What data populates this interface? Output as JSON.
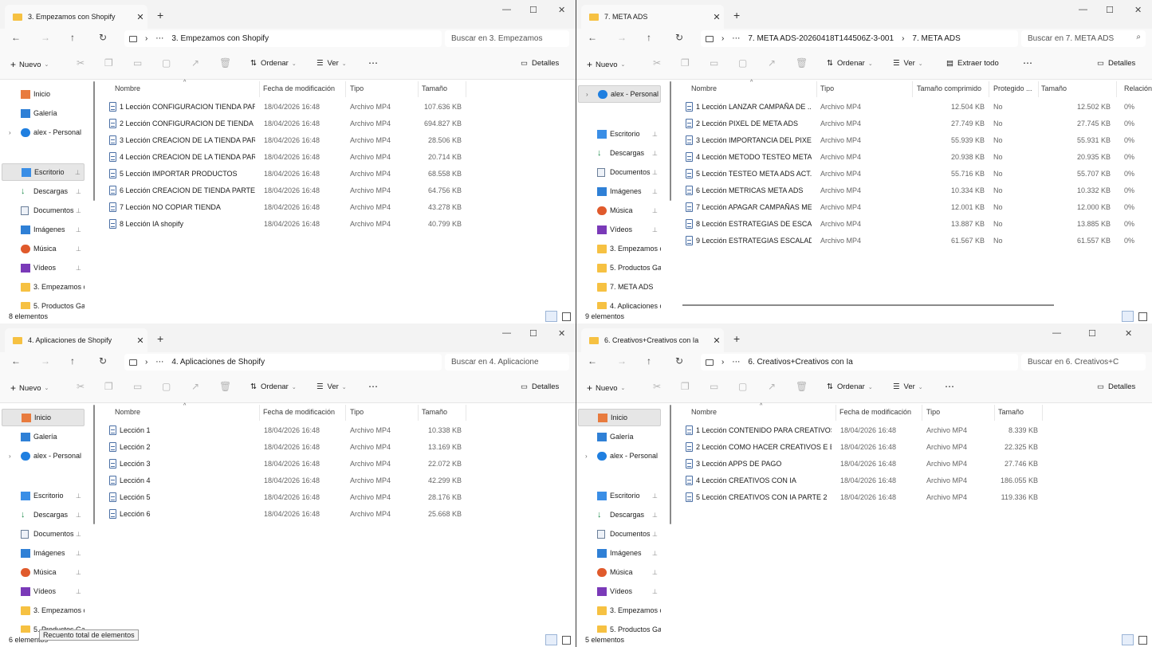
{
  "windows": [
    {
      "tab_title": "3. Empezamos con Shopify",
      "breadcrumb": [
        "3. Empezamos con Shopify"
      ],
      "search_placeholder": "Buscar en 3. Empezamos",
      "toolbar": {
        "new": "Nuevo",
        "sort": "Ordenar",
        "view": "Ver",
        "extract": "",
        "details": "Detalles"
      },
      "sidebar": [
        {
          "label": "Inicio",
          "icon": "home-icon",
          "selected": false
        },
        {
          "label": "Galería",
          "icon": "gallery-icon",
          "selected": false
        },
        {
          "label": "alex - Personal",
          "icon": "onedrive-icon",
          "selected": false,
          "expander": true
        },
        {
          "label": "Escritorio",
          "icon": "desktop-icon",
          "selected": true,
          "pinned": true
        },
        {
          "label": "Descargas",
          "icon": "downloads-icon",
          "pinned": true
        },
        {
          "label": "Documentos",
          "icon": "documents-icon",
          "pinned": true
        },
        {
          "label": "Imágenes",
          "icon": "pictures-icon",
          "pinned": true
        },
        {
          "label": "Música",
          "icon": "music-icon",
          "pinned": true
        },
        {
          "label": "Vídeos",
          "icon": "videos-icon",
          "pinned": true
        },
        {
          "label": "3. Empezamos c",
          "icon": "folder-icon"
        },
        {
          "label": "5. Productos Ga",
          "icon": "folder-icon"
        }
      ],
      "columns": [
        "Nombre",
        "Fecha de modificación",
        "Tipo",
        "Tamaño"
      ],
      "rows": [
        [
          "1 Lección CONFIGURACION TIENDA PAR...",
          "18/04/2026 16:48",
          "Archivo MP4",
          "107.636 KB"
        ],
        [
          "2 Lección CONFIGURACION DE TIENDA ...",
          "18/04/2026 16:48",
          "Archivo MP4",
          "694.827 KB"
        ],
        [
          "3 Lección CREACION DE LA TIENDA PAR...",
          "18/04/2026 16:48",
          "Archivo MP4",
          "28.506 KB"
        ],
        [
          "4 Lección CREACION DE LA TIENDA PAR...",
          "18/04/2026 16:48",
          "Archivo MP4",
          "20.714 KB"
        ],
        [
          "5 Lección IMPORTAR PRODUCTOS",
          "18/04/2026 16:48",
          "Archivo MP4",
          "68.558 KB"
        ],
        [
          "6 Lección CREACION DE TIENDA PARTE 4",
          "18/04/2026 16:48",
          "Archivo MP4",
          "64.756 KB"
        ],
        [
          "7 Lección NO COPIAR TIENDA",
          "18/04/2026 16:48",
          "Archivo MP4",
          "43.278 KB"
        ],
        [
          "8 Lección IA shopify",
          "18/04/2026 16:48",
          "Archivo MP4",
          "40.799 KB"
        ]
      ],
      "status": "8 elementos"
    },
    {
      "tab_title": "7. META ADS",
      "breadcrumb": [
        "7. META ADS-20260418T144506Z-3-001",
        "7. META ADS"
      ],
      "search_placeholder": "Buscar en 7. META ADS",
      "toolbar": {
        "new": "Nuevo",
        "sort": "Ordenar",
        "view": "Ver",
        "extract": "Extraer todo",
        "details": "Detalles"
      },
      "sidebar": [
        {
          "label": "alex - Personal",
          "icon": "onedrive-icon",
          "selected": true,
          "expander": true
        },
        {
          "label": "Escritorio",
          "icon": "desktop-icon",
          "pinned": true
        },
        {
          "label": "Descargas",
          "icon": "downloads-icon",
          "pinned": true
        },
        {
          "label": "Documentos",
          "icon": "documents-icon",
          "pinned": true
        },
        {
          "label": "Imágenes",
          "icon": "pictures-icon",
          "pinned": true
        },
        {
          "label": "Música",
          "icon": "music-icon",
          "pinned": true
        },
        {
          "label": "Vídeos",
          "icon": "videos-icon",
          "pinned": true
        },
        {
          "label": "3. Empezamos c",
          "icon": "folder-icon"
        },
        {
          "label": "5. Productos Ga",
          "icon": "folder-icon"
        },
        {
          "label": "7. META ADS",
          "icon": "folder-icon"
        },
        {
          "label": "4. Aplicaciones c",
          "icon": "folder-icon"
        }
      ],
      "columns": [
        "Nombre",
        "Tipo",
        "Tamaño comprimido",
        "Protegido ...",
        "Tamaño",
        "Relación"
      ],
      "rows": [
        [
          "1 Lección LANZAR CAMPAÑA DE ...",
          "Archivo MP4",
          "12.504 KB",
          "No",
          "12.502 KB",
          "0%"
        ],
        [
          "2 Lección PIXEL DE META ADS",
          "Archivo MP4",
          "27.749 KB",
          "No",
          "27.745 KB",
          "0%"
        ],
        [
          "3 Lección IMPORTANCIA DEL PIXEL",
          "Archivo MP4",
          "55.939 KB",
          "No",
          "55.931 KB",
          "0%"
        ],
        [
          "4 Lección METODO TESTEO META ...",
          "Archivo MP4",
          "20.938 KB",
          "No",
          "20.935 KB",
          "0%"
        ],
        [
          "5 Lección TESTEO META ADS ACT...",
          "Archivo MP4",
          "55.716 KB",
          "No",
          "55.707 KB",
          "0%"
        ],
        [
          "6 Lección METRICAS META ADS",
          "Archivo MP4",
          "10.334 KB",
          "No",
          "10.332 KB",
          "0%"
        ],
        [
          "7 Lección APAGAR CAMPAÑAS ME...",
          "Archivo MP4",
          "12.001 KB",
          "No",
          "12.000 KB",
          "0%"
        ],
        [
          "8 Lección ESTRATEGIAS DE ESCAL...",
          "Archivo MP4",
          "13.887 KB",
          "No",
          "13.885 KB",
          "0%"
        ],
        [
          "9 Lección ESTRATEGIAS ESCALAD...",
          "Archivo MP4",
          "61.567 KB",
          "No",
          "61.557 KB",
          "0%"
        ]
      ],
      "status": "9 elementos"
    },
    {
      "tab_title": "4. Aplicaciones de Shopify",
      "breadcrumb": [
        "4. Aplicaciones de Shopify"
      ],
      "search_placeholder": "Buscar en 4. Aplicacione",
      "toolbar": {
        "new": "Nuevo",
        "sort": "Ordenar",
        "view": "Ver",
        "extract": "",
        "details": "Detalles"
      },
      "sidebar": [
        {
          "label": "Inicio",
          "icon": "home-icon",
          "selected": true
        },
        {
          "label": "Galería",
          "icon": "gallery-icon"
        },
        {
          "label": "alex - Personal",
          "icon": "onedrive-icon",
          "expander": true
        },
        {
          "label": "Escritorio",
          "icon": "desktop-icon",
          "pinned": true
        },
        {
          "label": "Descargas",
          "icon": "downloads-icon",
          "pinned": true
        },
        {
          "label": "Documentos",
          "icon": "documents-icon",
          "pinned": true
        },
        {
          "label": "Imágenes",
          "icon": "pictures-icon",
          "pinned": true
        },
        {
          "label": "Música",
          "icon": "music-icon",
          "pinned": true
        },
        {
          "label": "Vídeos",
          "icon": "videos-icon",
          "pinned": true
        },
        {
          "label": "3. Empezamos c",
          "icon": "folder-icon"
        },
        {
          "label": "5. Productos Ga",
          "icon": "folder-icon"
        }
      ],
      "columns": [
        "Nombre",
        "Fecha de modificación",
        "Tipo",
        "Tamaño"
      ],
      "rows": [
        [
          "Lección 1",
          "18/04/2026 16:48",
          "Archivo MP4",
          "10.338 KB"
        ],
        [
          "Lección 2",
          "18/04/2026 16:48",
          "Archivo MP4",
          "13.169 KB"
        ],
        [
          "Lección 3",
          "18/04/2026 16:48",
          "Archivo MP4",
          "22.072 KB"
        ],
        [
          "Lección 4",
          "18/04/2026 16:48",
          "Archivo MP4",
          "42.299 KB"
        ],
        [
          "Lección 5",
          "18/04/2026 16:48",
          "Archivo MP4",
          "28.176 KB"
        ],
        [
          "Lección 6",
          "18/04/2026 16:48",
          "Archivo MP4",
          "25.668 KB"
        ]
      ],
      "status": "6 elementos",
      "tooltip": "Recuento total de elementos"
    },
    {
      "tab_title": "6. Creativos+Creativos con Ia",
      "breadcrumb": [
        "6. Creativos+Creativos con Ia"
      ],
      "search_placeholder": "Buscar en 6. Creativos+C",
      "toolbar": {
        "new": "Nuevo",
        "sort": "Ordenar",
        "view": "Ver",
        "extract": "",
        "details": "Detalles"
      },
      "sidebar": [
        {
          "label": "Inicio",
          "icon": "home-icon",
          "selected": true
        },
        {
          "label": "Galería",
          "icon": "gallery-icon"
        },
        {
          "label": "alex - Personal",
          "icon": "onedrive-icon",
          "expander": true
        },
        {
          "label": "Escritorio",
          "icon": "desktop-icon",
          "pinned": true
        },
        {
          "label": "Descargas",
          "icon": "downloads-icon",
          "pinned": true
        },
        {
          "label": "Documentos",
          "icon": "documents-icon",
          "pinned": true
        },
        {
          "label": "Imágenes",
          "icon": "pictures-icon",
          "pinned": true
        },
        {
          "label": "Música",
          "icon": "music-icon",
          "pinned": true
        },
        {
          "label": "Vídeos",
          "icon": "videos-icon",
          "pinned": true
        },
        {
          "label": "3. Empezamos c",
          "icon": "folder-icon"
        },
        {
          "label": "5. Productos Ga",
          "icon": "folder-icon"
        }
      ],
      "columns": [
        "Nombre",
        "Fecha de modificación",
        "Tipo",
        "Tamaño"
      ],
      "rows": [
        [
          "1 Lección CONTENIDO PARA CREATIVOS",
          "18/04/2026 16:48",
          "Archivo MP4",
          "8.339 KB"
        ],
        [
          "2 Lección COMO HACER CREATIVOS E E...",
          "18/04/2026 16:48",
          "Archivo MP4",
          "22.325 KB"
        ],
        [
          "3 Lección APPS DE PAGO",
          "18/04/2026 16:48",
          "Archivo MP4",
          "27.746 KB"
        ],
        [
          "4 Lección CREATIVOS CON IA",
          "18/04/2026 16:48",
          "Archivo MP4",
          "186.055 KB"
        ],
        [
          "5 Lección CREATIVOS CON IA PARTE 2",
          "18/04/2026 16:48",
          "Archivo MP4",
          "119.336 KB"
        ]
      ],
      "status": "5 elementos"
    }
  ],
  "glyphs": {
    "back": "←",
    "forward": "→",
    "up": "↑",
    "refresh": "↻",
    "more": "⋯",
    "chevron": "›",
    "close": "✕",
    "plus": "+",
    "minimize": "—",
    "maximize": "☐",
    "pin": "📌",
    "cut": "✂",
    "expander": "›",
    "search": "⌕",
    "sort_up": "^"
  },
  "colors": {
    "folder": "#f6c142",
    "selection": "#e6e6e6",
    "accent": "#1f7fe0"
  }
}
